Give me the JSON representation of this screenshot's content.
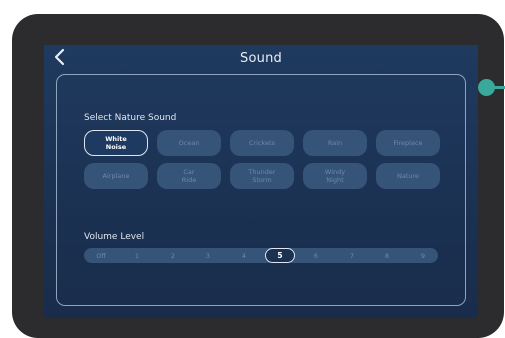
{
  "header": {
    "title": "Sound",
    "back_icon": "chevron-left-icon"
  },
  "nature_sound": {
    "label": "Select Nature Sound",
    "options": [
      {
        "label": "White\nNoise",
        "selected": true
      },
      {
        "label": "Ocean",
        "selected": false
      },
      {
        "label": "Crickets",
        "selected": false
      },
      {
        "label": "Rain",
        "selected": false
      },
      {
        "label": "Fireplace",
        "selected": false
      },
      {
        "label": "Airplane",
        "selected": false
      },
      {
        "label": "Car\nRide",
        "selected": false
      },
      {
        "label": "Thunder\nStorm",
        "selected": false
      },
      {
        "label": "Windy\nNight",
        "selected": false
      },
      {
        "label": "Nature",
        "selected": false
      }
    ]
  },
  "volume": {
    "label": "Volume Level",
    "levels": [
      "Off",
      "1",
      "2",
      "3",
      "4",
      "5",
      "6",
      "7",
      "8",
      "9"
    ],
    "selected": "5"
  },
  "colors": {
    "screen_bg": "#1f3a5f",
    "chip_bg": "#365378",
    "chip_text": "#6f88ad",
    "selected_border": "#dfe6f1",
    "callout": "#3aa89a"
  }
}
